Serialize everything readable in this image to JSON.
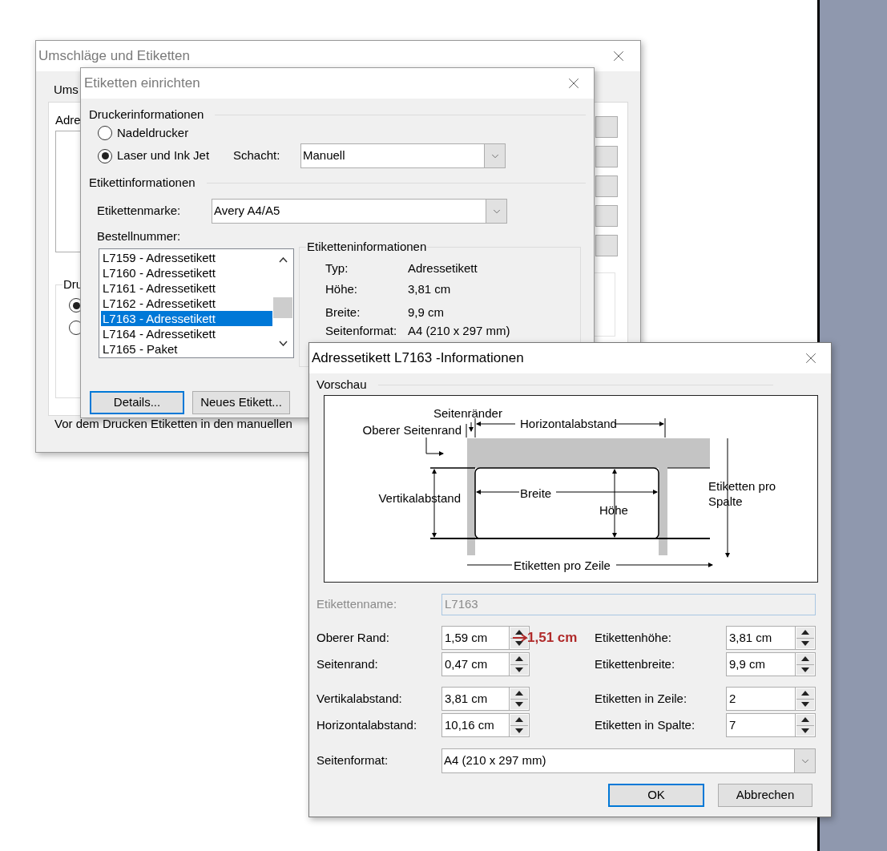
{
  "envelopes_dialog": {
    "title": "Umschläge und Etiketten",
    "tab": "Ums",
    "address_label": "Adre",
    "group_label": "Dru",
    "radios": [
      {
        "selected": true
      },
      {
        "selected": false
      }
    ],
    "footer_text": "Vor dem Drucken Etiketten in den manuellen"
  },
  "setup_dialog": {
    "title": "Etiketten einrichten",
    "printer_section": "Druckerinformationen",
    "printer_types": [
      {
        "label": "Nadeldrucker",
        "selected": false
      },
      {
        "label": "Laser und Ink Jet",
        "selected": true
      }
    ],
    "tray_label": "Schacht:",
    "tray_value": "Manuell",
    "label_section": "Etikettinformationen",
    "brand_label": "Etikettenmarke:",
    "brand_value": "Avery A4/A5",
    "order_label": "Bestellnummer:",
    "order_items": [
      {
        "label": "L7159 - Adressetikett",
        "selected": false
      },
      {
        "label": "L7160 - Adressetikett",
        "selected": false
      },
      {
        "label": "L7161 - Adressetikett",
        "selected": false
      },
      {
        "label": "L7162 - Adressetikett",
        "selected": false
      },
      {
        "label": "L7163 - Adressetikett",
        "selected": true
      },
      {
        "label": "L7164 - Adressetikett",
        "selected": false
      },
      {
        "label": "L7165 - Paket",
        "selected": false
      }
    ],
    "info_group": {
      "title": "Etiketteninformationen",
      "rows": [
        {
          "label": "Typ:",
          "value": "Adressetikett"
        },
        {
          "label": "Höhe:",
          "value": "3,81 cm"
        },
        {
          "label": "Breite:",
          "value": "9,9 cm"
        },
        {
          "label": "Seitenformat:",
          "value": "A4 (210 x 297 mm)"
        }
      ]
    },
    "buttons": [
      "Details...",
      "Neues Etikett..."
    ]
  },
  "info_dialog": {
    "title": "Adressetikett L7163 -Informationen",
    "preview_label": "Vorschau",
    "diagram": {
      "side_margins": "Seitenränder",
      "top_margin": "Oberer Seitenrand",
      "horizontal_pitch": "Horizontalabstand",
      "vertical_pitch": "Vertikalabstand",
      "width": "Breite",
      "height": "Höhe",
      "per_column": "Etiketten pro Spalte",
      "per_row": "Etiketten pro Zeile"
    },
    "name_field": {
      "label": "Etikettenname:",
      "value": "L7163",
      "disabled": true
    },
    "fields_left": [
      {
        "label": "Oberer Rand:",
        "value": "1,59 cm"
      },
      {
        "label": "Seitenrand:",
        "value": "0,47 cm"
      },
      {
        "label": "Vertikalabstand:",
        "value": "3,81 cm"
      },
      {
        "label": "Horizontalabstand:",
        "value": "10,16 cm"
      }
    ],
    "fields_right": [
      {
        "label": "Etikettenhöhe:",
        "value": "3,81 cm"
      },
      {
        "label": "Etikettenbreite:",
        "value": "9,9 cm"
      },
      {
        "label": "Etiketten in Zeile:",
        "value": "2"
      },
      {
        "label": "Etiketten in Spalte:",
        "value": "7"
      }
    ],
    "annotation": "1,51 cm",
    "page_format": {
      "label": "Seitenformat:",
      "value": "A4 (210 x 297 mm)"
    },
    "buttons": [
      "OK",
      "Abbrechen"
    ]
  }
}
